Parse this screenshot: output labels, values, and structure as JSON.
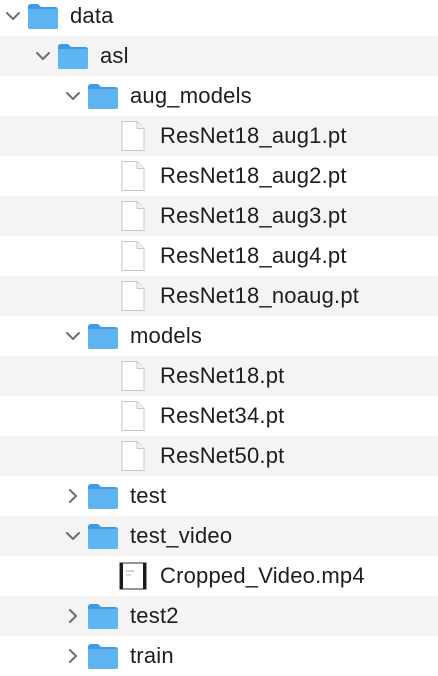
{
  "colors": {
    "folder_front": "#5fb4f2",
    "folder_back": "#3e9be3",
    "row_alt": "#f4f4f5",
    "text": "#1d1d1f",
    "chevron": "#6e6e73"
  },
  "tree": [
    {
      "name": "data",
      "kind": "folder",
      "depth": 0,
      "state": "expanded",
      "icon": "folder-icon"
    },
    {
      "name": "asl",
      "kind": "folder",
      "depth": 1,
      "state": "expanded",
      "icon": "folder-icon"
    },
    {
      "name": "aug_models",
      "kind": "folder",
      "depth": 2,
      "state": "expanded",
      "icon": "folder-icon"
    },
    {
      "name": "ResNet18_aug1.pt",
      "kind": "file",
      "depth": 3,
      "icon": "document-icon"
    },
    {
      "name": "ResNet18_aug2.pt",
      "kind": "file",
      "depth": 3,
      "icon": "document-icon"
    },
    {
      "name": "ResNet18_aug3.pt",
      "kind": "file",
      "depth": 3,
      "icon": "document-icon"
    },
    {
      "name": "ResNet18_aug4.pt",
      "kind": "file",
      "depth": 3,
      "icon": "document-icon"
    },
    {
      "name": "ResNet18_noaug.pt",
      "kind": "file",
      "depth": 3,
      "icon": "document-icon"
    },
    {
      "name": "models",
      "kind": "folder",
      "depth": 2,
      "state": "expanded",
      "icon": "folder-icon"
    },
    {
      "name": "ResNet18.pt",
      "kind": "file",
      "depth": 3,
      "icon": "document-icon"
    },
    {
      "name": "ResNet34.pt",
      "kind": "file",
      "depth": 3,
      "icon": "document-icon"
    },
    {
      "name": "ResNet50.pt",
      "kind": "file",
      "depth": 3,
      "icon": "document-icon"
    },
    {
      "name": "test",
      "kind": "folder",
      "depth": 2,
      "state": "collapsed",
      "icon": "folder-icon"
    },
    {
      "name": "test_video",
      "kind": "folder",
      "depth": 2,
      "state": "expanded",
      "icon": "folder-icon"
    },
    {
      "name": "Cropped_Video.mp4",
      "kind": "file",
      "depth": 3,
      "icon": "video-thumbnail-icon"
    },
    {
      "name": "test2",
      "kind": "folder",
      "depth": 2,
      "state": "collapsed",
      "icon": "folder-icon"
    },
    {
      "name": "train",
      "kind": "folder",
      "depth": 2,
      "state": "collapsed",
      "icon": "folder-icon"
    }
  ]
}
